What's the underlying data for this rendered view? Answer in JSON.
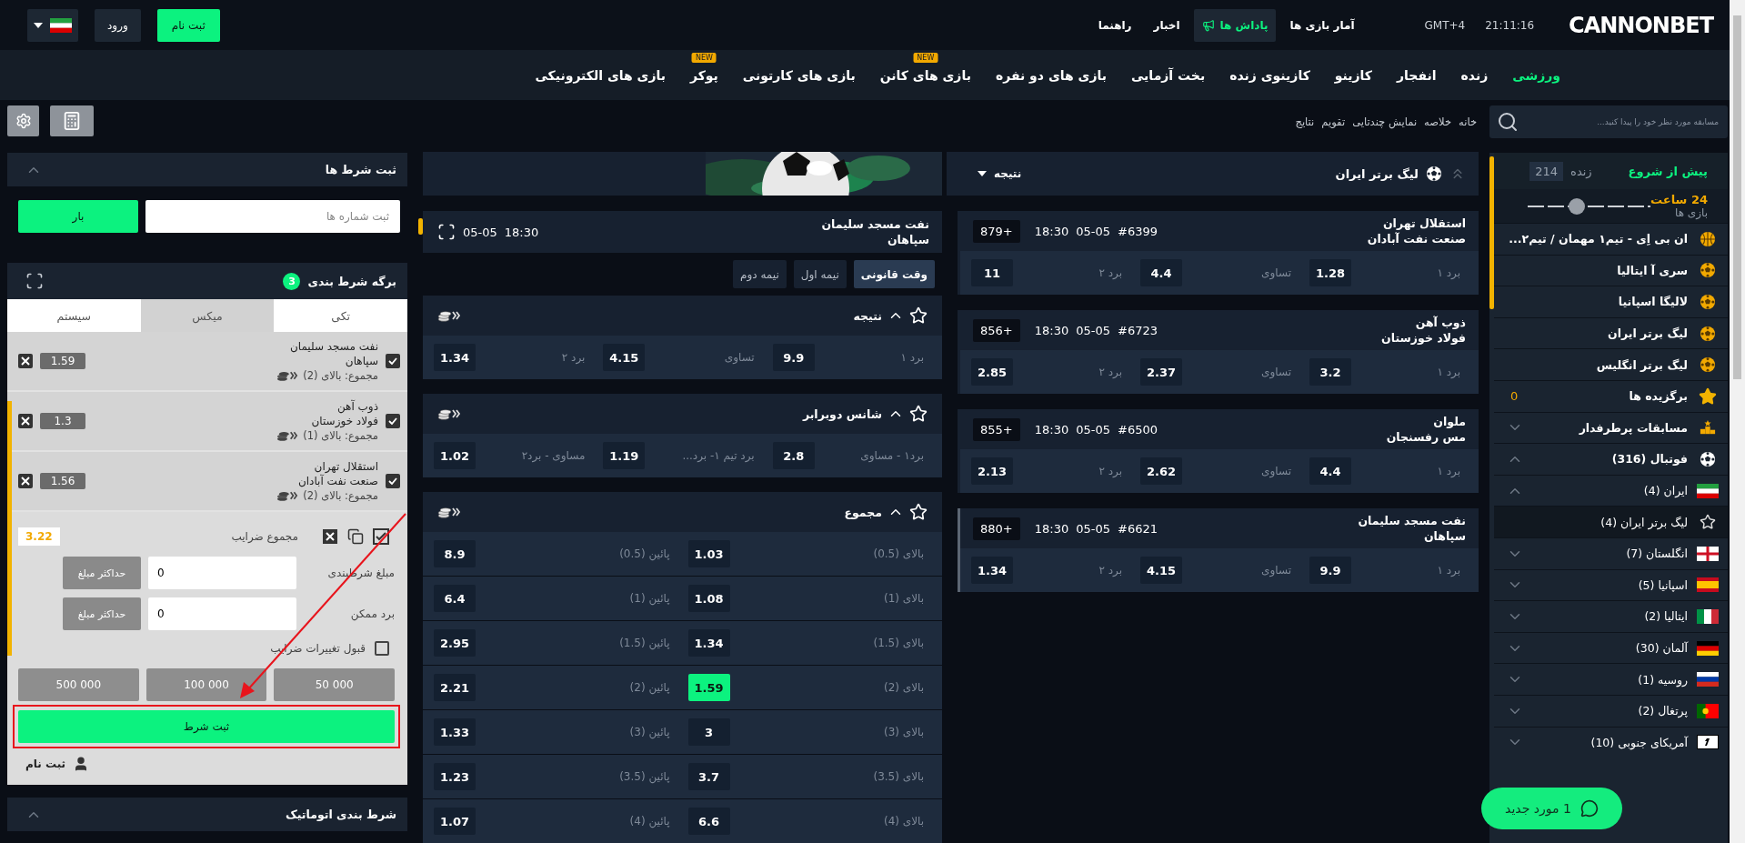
{
  "header": {
    "logo": "CANNONBET",
    "time": "21:11:16",
    "timezone": "GMT+4",
    "links": [
      {
        "label": "آمار بازی ها",
        "highlighted": false
      },
      {
        "label": "پاداش ها",
        "highlighted": true
      },
      {
        "label": "اخبار",
        "highlighted": false
      },
      {
        "label": "راهنما",
        "highlighted": false
      }
    ],
    "register": "ثبت نام",
    "login": "ورود"
  },
  "nav": [
    {
      "label": "ورزشی",
      "selected": true
    },
    {
      "label": "زنده",
      "selected": false
    },
    {
      "label": "انفجار",
      "selected": false
    },
    {
      "label": "کازینو",
      "selected": false
    },
    {
      "label": "کازینوی زنده",
      "selected": false
    },
    {
      "label": "بخت آزمایی",
      "selected": false
    },
    {
      "label": "بازی های دو نفره",
      "selected": false
    },
    {
      "label": "بازی های کانن",
      "selected": false,
      "badge": "NEW"
    },
    {
      "label": "بازی های کارتونی",
      "selected": false
    },
    {
      "label": "پوکر",
      "selected": false,
      "badge": "NEW"
    },
    {
      "label": "بازی های الکترونیکی",
      "selected": false
    }
  ],
  "breadcrumbs": [
    "خانه",
    "خلاصه",
    "نمایش چندتایی",
    "تقویم",
    "نتایج"
  ],
  "sidebar": {
    "search": {
      "placeholder": "مسابقه مورد نظر خود را پیدا کنید..."
    },
    "tabs": [
      {
        "label": "پیش از شروع",
        "selected": true
      },
      {
        "label": "زنده",
        "selected": false,
        "count": "214"
      }
    ],
    "period": {
      "label": "24 ساعت",
      "caption": "بازی ها",
      "level": 0.4
    },
    "items": [
      {
        "kind": "basketball",
        "label": "ان بی اِی - تیم۱ مهمان / تیم۲...",
        "selected": false
      },
      {
        "kind": "league",
        "label": "سری آ ایتالیا",
        "selected": false
      },
      {
        "kind": "league",
        "label": "لالیگا اسپانیا",
        "selected": false
      },
      {
        "kind": "league",
        "label": "لیگ برتر ایران",
        "selected": false
      },
      {
        "kind": "league",
        "label": "لیگ برتر انگلیس",
        "selected": false
      },
      {
        "kind": "favorites",
        "label": "برگزیده ها",
        "count": "0",
        "selected": false
      },
      {
        "kind": "top",
        "label": "مسابقات پرطرفدار",
        "expanded": false,
        "selected": false
      },
      {
        "kind": "sport",
        "label": "فوتبال (316)",
        "expanded": true,
        "selected": false,
        "children": [
          {
            "kind": "country",
            "label": "ایران (4)",
            "expanded": true,
            "selected": false,
            "children": [
              {
                "kind": "tournament",
                "label": "لیگ برتر ایران (4)",
                "selected": true
              }
            ]
          },
          {
            "kind": "country",
            "label": "انگلستان (7)",
            "expanded": false,
            "selected": false
          },
          {
            "kind": "country",
            "label": "اسپانیا (5)",
            "expanded": false,
            "selected": false
          },
          {
            "kind": "country",
            "label": "ایتالیا (2)",
            "expanded": false,
            "selected": false
          },
          {
            "kind": "country",
            "label": "آلمان (30)",
            "expanded": false,
            "selected": false
          },
          {
            "kind": "country",
            "label": "روسیه (1)",
            "expanded": false,
            "selected": false
          },
          {
            "kind": "country",
            "label": "پرتغال (2)",
            "expanded": false,
            "selected": false
          },
          {
            "kind": "country",
            "label": "آمریکای جنوبی (10)",
            "expanded": false,
            "selected": false
          }
        ]
      }
    ]
  },
  "chat": {
    "label": "1 مورد جدید"
  },
  "bet_code": {
    "title": "ثبت شرط ها",
    "placeholder": "ثبت شماره ها",
    "button": "بار"
  },
  "betslip": {
    "title": "برگه شرط بندی",
    "count": "3",
    "tabs": [
      {
        "label": "تکی",
        "selected": false
      },
      {
        "label": "میکس",
        "selected": true
      },
      {
        "label": "سیستم",
        "selected": false
      }
    ],
    "bets": [
      {
        "teams": [
          "نفت مسجد سلیمان",
          "سپاهان"
        ],
        "market": "مجموع: بالای (2)",
        "odds": "1.59",
        "checked": true
      },
      {
        "teams": [
          "ذوب آهن",
          "فولاد خوزستان"
        ],
        "market": "مجموع: بالای (1)",
        "odds": "1.3",
        "checked": true
      },
      {
        "teams": [
          "استقلال تهران",
          "صنعت نفت آبادان"
        ],
        "market": "مجموع: بالای (2)",
        "odds": "1.56",
        "checked": true
      }
    ],
    "total_label": "مجموع ضرایب",
    "total": "3.22",
    "stake": {
      "label": "مبلغ شرطبندی",
      "value": "0",
      "button": "حداکثر مبلغ"
    },
    "win": {
      "label": "برد ممکن",
      "value": "0",
      "button": "حداکثر مبلغ"
    },
    "accept": {
      "label": "قبول تغییرات ضرایب",
      "checked": false
    },
    "amounts": [
      "50 000",
      "100 000",
      "500 000"
    ],
    "place": {
      "label": "ثبت شرط",
      "highlighted": true
    },
    "register": "ثبت نام"
  },
  "auto_bet": {
    "title": "شرط بندی اتوماتیک"
  },
  "league": {
    "title": "لیگ برتر ایران",
    "market": "نتیجه"
  },
  "matches": [
    {
      "teams": [
        "استقلال تهران",
        "صنعت نفت آبادان"
      ],
      "id": "#6399",
      "date": "05-05",
      "time": "18:30",
      "more": "+879",
      "selected": false,
      "odds": [
        {
          "label": "برد ۱",
          "value": "1.28"
        },
        {
          "label": "تساوی",
          "value": "4.4"
        },
        {
          "label": "برد ۲",
          "value": "11"
        }
      ]
    },
    {
      "teams": [
        "ذوب آهن",
        "فولاد خوزستان"
      ],
      "id": "#6723",
      "date": "05-05",
      "time": "18:30",
      "more": "+856",
      "selected": false,
      "odds": [
        {
          "label": "برد ۱",
          "value": "3.2"
        },
        {
          "label": "تساوی",
          "value": "2.37"
        },
        {
          "label": "برد ۲",
          "value": "2.85"
        }
      ]
    },
    {
      "teams": [
        "ملوان",
        "مس رفسنجان"
      ],
      "id": "#6500",
      "date": "05-05",
      "time": "18:30",
      "more": "+855",
      "selected": false,
      "odds": [
        {
          "label": "برد ۱",
          "value": "4.4"
        },
        {
          "label": "تساوی",
          "value": "2.62"
        },
        {
          "label": "برد ۲",
          "value": "2.13"
        }
      ]
    },
    {
      "teams": [
        "نفت مسجد سلیمان",
        "سپاهان"
      ],
      "id": "#6621",
      "date": "05-05",
      "time": "18:30",
      "more": "+880",
      "selected": true,
      "odds": [
        {
          "label": "برد ۱",
          "value": "9.9"
        },
        {
          "label": "تساوی",
          "value": "4.15"
        },
        {
          "label": "برد ۲",
          "value": "1.34"
        }
      ]
    }
  ],
  "event": {
    "teams": [
      "نفت مسجد سلیمان",
      "سپاهان"
    ],
    "time": "18:30",
    "date": "05-05",
    "periods": [
      {
        "label": "وقت قانونی",
        "selected": true
      },
      {
        "label": "نیمه اول",
        "selected": false
      },
      {
        "label": "نیمه دوم",
        "selected": false
      }
    ],
    "markets": [
      {
        "title": "نتیجه",
        "expanded": true,
        "rows": [
          [
            {
              "label": "برد ۱",
              "odds": "9.9",
              "selected": false
            },
            {
              "label": "تساوی",
              "odds": "4.15",
              "selected": false
            },
            {
              "label": "برد ۲",
              "odds": "1.34",
              "selected": false
            }
          ]
        ]
      },
      {
        "title": "شانس دوبرابر",
        "expanded": true,
        "rows": [
          [
            {
              "label": "برد۱ - مساوی",
              "odds": "2.8",
              "selected": false
            },
            {
              "label": "برد تیم ۱- برد...",
              "odds": "1.19",
              "selected": false
            },
            {
              "label": "مساوی - برد۲",
              "odds": "1.02",
              "selected": false
            }
          ]
        ]
      },
      {
        "title": "مجموع",
        "expanded": true,
        "rows": [
          [
            {
              "label": "بالای (0.5)",
              "odds": "1.03",
              "selected": false
            },
            {
              "label": "پائین (0.5)",
              "odds": "8.9",
              "selected": false
            }
          ],
          [
            {
              "label": "بالای (1)",
              "odds": "1.08",
              "selected": false
            },
            {
              "label": "پائین (1)",
              "odds": "6.4",
              "selected": false
            }
          ],
          [
            {
              "label": "بالای (1.5)",
              "odds": "1.34",
              "selected": false
            },
            {
              "label": "پائین (1.5)",
              "odds": "2.95",
              "selected": false
            }
          ],
          [
            {
              "label": "بالای (2)",
              "odds": "1.59",
              "selected": true
            },
            {
              "label": "پائین (2)",
              "odds": "2.21",
              "selected": false
            }
          ],
          [
            {
              "label": "بالای (3)",
              "odds": "3",
              "selected": false
            },
            {
              "label": "پائین (3)",
              "odds": "1.33",
              "selected": false
            }
          ],
          [
            {
              "label": "بالای (3.5)",
              "odds": "3.7",
              "selected": false
            },
            {
              "label": "پائین (3.5)",
              "odds": "1.23",
              "selected": false
            }
          ],
          [
            {
              "label": "بالای (4)",
              "odds": "6.6",
              "selected": false
            },
            {
              "label": "پائین (4)",
              "odds": "1.07",
              "selected": false
            }
          ]
        ]
      }
    ]
  }
}
